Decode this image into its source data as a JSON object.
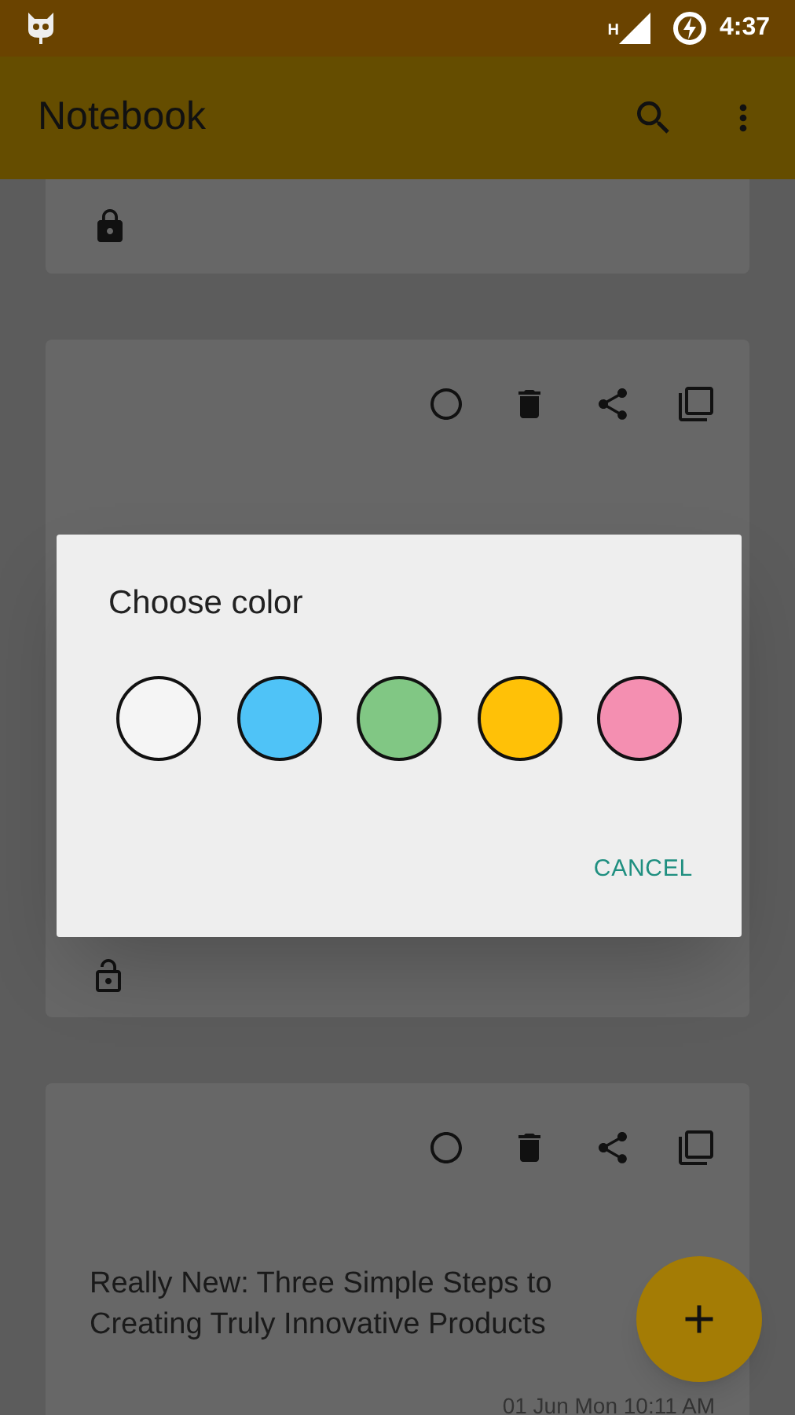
{
  "status_bar": {
    "network": "H",
    "time": "4:37"
  },
  "app_bar": {
    "title": "Notebook"
  },
  "notes": [
    {
      "locked": true
    },
    {
      "locked": false
    },
    {
      "title": "Really New: Three Simple Steps to Creating Truly Innovative Products",
      "date": "01 Jun Mon 10:11 AM"
    }
  ],
  "dialog": {
    "title": "Choose color",
    "colors": [
      {
        "color": "#f5f5f5"
      },
      {
        "color": "#4fc3f7"
      },
      {
        "color": "#81c784"
      },
      {
        "color": "#ffc107"
      },
      {
        "color": "#f48fb1"
      }
    ],
    "cancel": "CANCEL"
  }
}
